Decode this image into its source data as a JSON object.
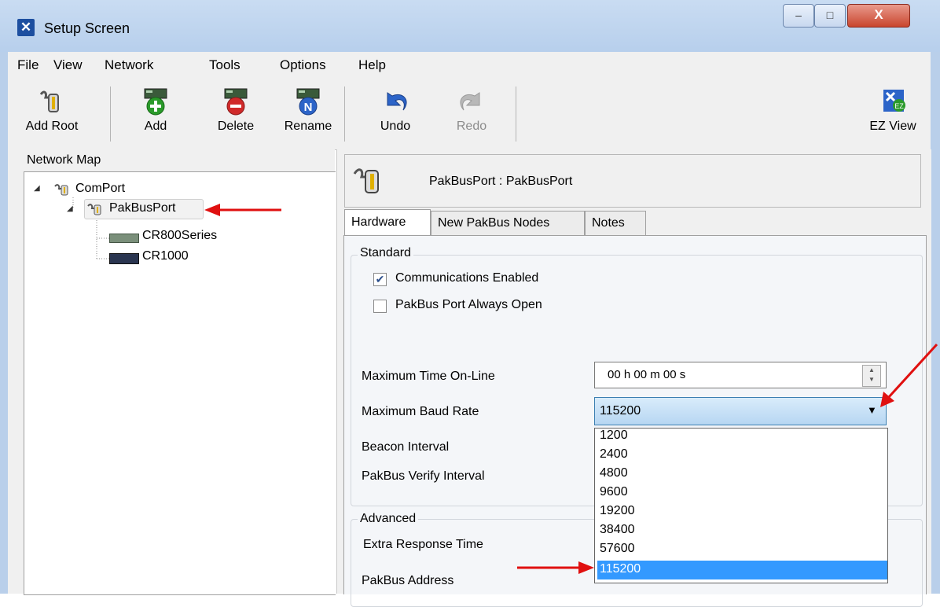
{
  "window": {
    "title": "Setup Screen",
    "app_icon": "setup-screen-icon",
    "close_glyph": "X",
    "min_glyph": "–",
    "max_glyph": "□"
  },
  "menu": [
    "File",
    "View",
    "Network",
    "Tools",
    "Options",
    "Help"
  ],
  "toolbar": {
    "add_root": "Add Root",
    "add": "Add",
    "delete": "Delete",
    "rename": "Rename",
    "undo": "Undo",
    "redo": "Redo",
    "ez_view": "EZ View"
  },
  "network_map": {
    "label": "Network Map",
    "nodes": [
      "ComPort",
      "PakBusPort",
      "CR800Series",
      "CR1000"
    ]
  },
  "device": {
    "title": "PakBusPort : PakBusPort"
  },
  "tabs": [
    "Hardware",
    "New PakBus Nodes",
    "Notes"
  ],
  "standard": {
    "group_label": "Standard",
    "comm_enabled_label": "Communications Enabled",
    "comm_enabled": true,
    "port_open_label": "PakBus Port Always Open",
    "port_open": false,
    "max_time_label": "Maximum Time On-Line",
    "max_time_value": "00 h 00 m 00 s",
    "max_baud_label": "Maximum Baud Rate",
    "max_baud_value": "115200",
    "beacon_label": "Beacon Interval",
    "verify_label": "PakBus Verify Interval"
  },
  "baud_options": [
    "1200",
    "2400",
    "4800",
    "9600",
    "19200",
    "38400",
    "57600",
    "115200"
  ],
  "baud_selected": "115200",
  "advanced": {
    "group_label": "Advanced",
    "extra_response_label": "Extra Response Time",
    "pakbus_address_label": "PakBus Address"
  },
  "colors": {
    "annotation_arrow": "#e01010",
    "selection": "#3399ff"
  }
}
